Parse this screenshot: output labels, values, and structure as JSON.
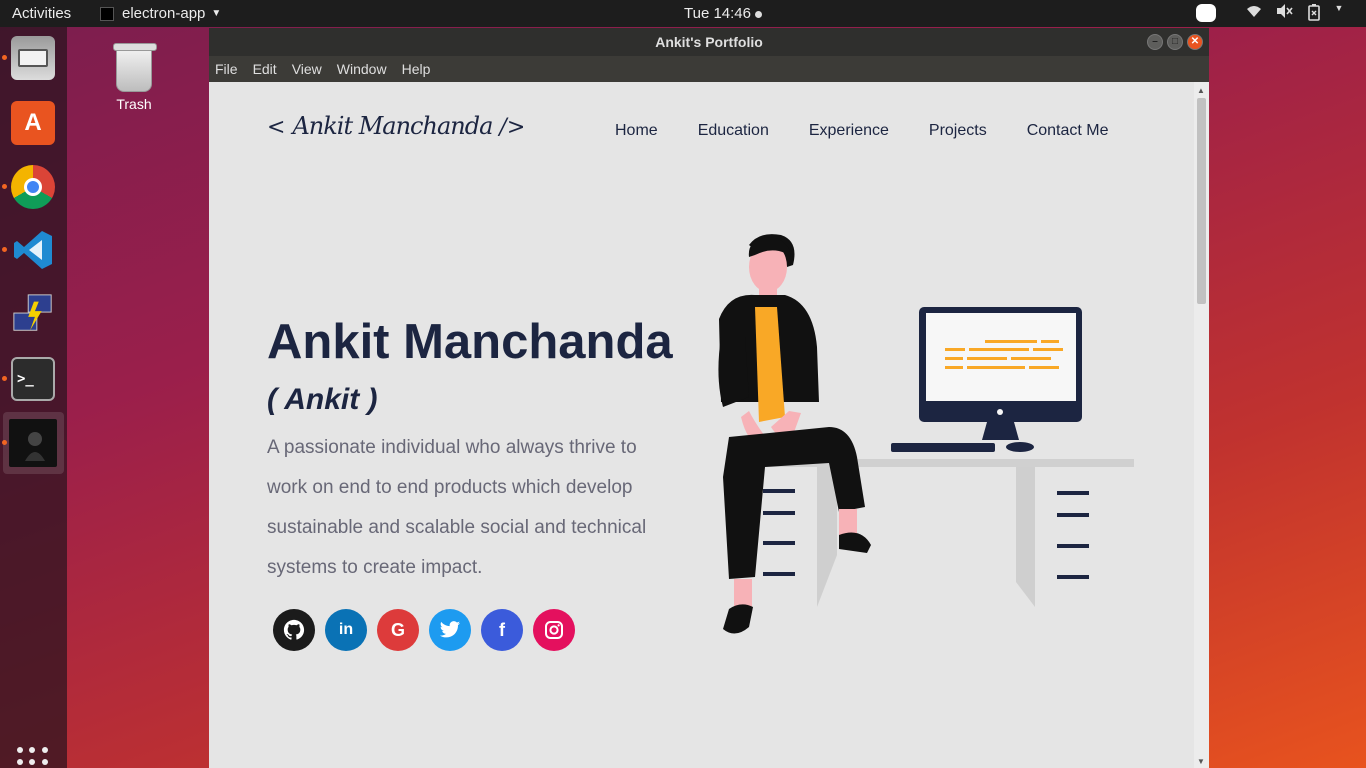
{
  "topbar": {
    "activities": "Activities",
    "app_name": "electron-app",
    "clock": "Tue 14:46"
  },
  "desktop": {
    "trash_label": "Trash"
  },
  "window": {
    "title": "Ankit's Portfolio",
    "menu": [
      "File",
      "Edit",
      "View",
      "Window",
      "Help"
    ]
  },
  "page": {
    "logo_left": "<",
    "logo_sig": "Ankit Manchanda",
    "logo_right": "/>",
    "nav": [
      "Home",
      "Education",
      "Experience",
      "Projects",
      "Contact Me"
    ],
    "name": "Ankit Manchanda",
    "nickname": "( Ankit )",
    "description": "A passionate individual who always thrive to work on end to end products which develop sustainable and scalable social and technical systems to create impact.",
    "socials": [
      "github",
      "linkedin",
      "google",
      "twitter",
      "facebook",
      "instagram"
    ],
    "accent_color": "#1c2541",
    "code_color": "#f9a826"
  }
}
